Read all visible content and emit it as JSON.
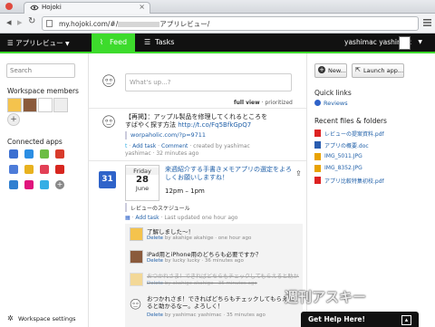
{
  "browser": {
    "tab_title": "Hojoki",
    "url_prefix": "my.hojoki.com/#/",
    "url_suffix": "アプリレビュー/"
  },
  "appbar": {
    "workspace": "アプリレビュー",
    "feed": "Feed",
    "tasks": "Tasks",
    "user": "yashimac yashimac"
  },
  "sidebar": {
    "search_placeholder": "Search",
    "members_title": "Workspace members",
    "apps_title": "Connected apps",
    "settings": "Workspace settings"
  },
  "composer": {
    "placeholder": "What's up...?",
    "view_full": "full view",
    "view_sep": " · ",
    "view_prioritized": "prioritized"
  },
  "post1": {
    "text_line1": "【再掲】：アップル製品を修理してくれるところを",
    "text_line2": "すばやく探す方法",
    "link": "http://t.co/Fq5BfkGpQ7",
    "ref": "worpaholic.com/?p=9711",
    "actions_add": "Add task",
    "actions_comment": "Comment",
    "created": "created by yashimac",
    "meta": "yashimac · 32 minutes ago"
  },
  "event": {
    "weekday": "Friday",
    "day": "28",
    "month": "June",
    "title_line1": "来週紹介する手書きメモアプリの選定をよろ",
    "title_line2": "しくお願いしますね！",
    "time": "12pm – 1pm",
    "calendar": "レビューのスケジュール",
    "actions_add": "Add task",
    "updated": "Last updated",
    "ago": "one hour ago",
    "calendar_day": "31"
  },
  "comments": [
    {
      "text": "了解しました～！",
      "delete": "Delete",
      "meta": "by akahige akahige · one hour ago"
    },
    {
      "text": "iPad用とiPhone用のどちらも必要ですか？",
      "delete": "Delete",
      "meta": "by lucky lucky · 36 minutes ago"
    },
    {
      "text": "おつかれさま！できればどちらもチェックしてもらえると助かるなー。よろしく！",
      "delete": "Delete",
      "meta": "by akahige akahige · 35 minutes ago"
    },
    {
      "text_line1": "おつかれさま！できればどちらもチェックしてもらえ",
      "text_line2": "ると助かるなー。よろしく！",
      "delete": "Delete",
      "meta": "by yashimac yashimac · 35 minutes ago"
    }
  ],
  "right": {
    "new_btn": "New...",
    "launch_btn": "Launch app...",
    "quick_links": "Quick links",
    "reviews": "Reviews",
    "recent_title": "Recent files & folders",
    "files": [
      {
        "name": "レビューの提案資料.pdf",
        "color": "#d22"
      },
      {
        "name": "アプリの概要.doc",
        "color": "#2a5db0"
      },
      {
        "name": "IMG_5011.JPG",
        "color": "#e8a200"
      },
      {
        "name": "IMG_8352.JPG",
        "color": "#e8a200"
      },
      {
        "name": "アプリ比較特集初校.pdf",
        "color": "#d22"
      }
    ]
  },
  "help": "Get Help Here!",
  "watermark": "週刊アスキー",
  "colors": {
    "accent": "#3ddb2c",
    "appbar": "#111111",
    "link": "#1f5fa8"
  }
}
